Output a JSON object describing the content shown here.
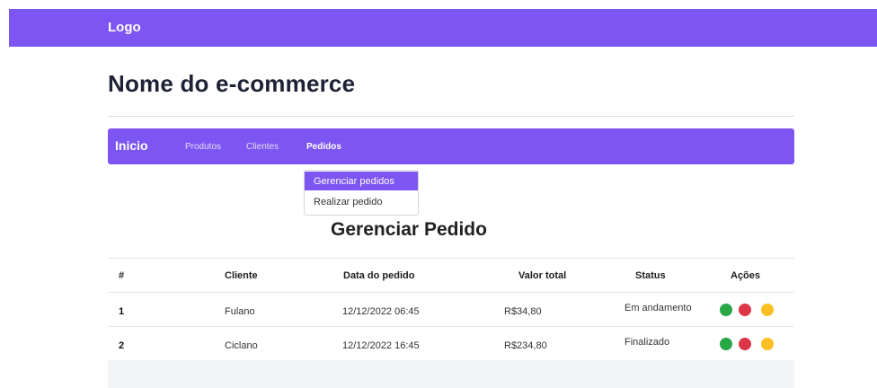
{
  "header": {
    "logo": "Logo"
  },
  "site": {
    "title": "Nome do e-commerce"
  },
  "nav": {
    "brand": "Inicio",
    "links": [
      "Produtos",
      "Clientes",
      "Pedidos"
    ],
    "active": "Pedidos"
  },
  "dropdown": {
    "items": [
      "Gerenciar pedidos",
      "Realizar pedido"
    ],
    "active": "Gerenciar pedidos"
  },
  "page": {
    "heading": "Gerenciar Pedido"
  },
  "table": {
    "headers": [
      "#",
      "Cliente",
      "Data do pedido",
      "Valor total",
      "Status",
      "Ações"
    ],
    "rows": [
      {
        "id": "1",
        "cliente": "Fulano",
        "data": "12/12/2022 06:45",
        "valor": "R$34,80",
        "status": "Em andamento"
      },
      {
        "id": "2",
        "cliente": "Ciclano",
        "data": "12/12/2022 16:45",
        "valor": "R$234,80",
        "status": "Finalizado"
      }
    ]
  },
  "actions": {
    "buttons": [
      {
        "icon": "green-action-icon",
        "color": "#28a745"
      },
      {
        "icon": "red-action-icon",
        "color": "#dc3545"
      },
      {
        "icon": "yellow-action-icon",
        "color": "#fbbf24"
      }
    ]
  },
  "colors": {
    "brand": "#7c55f2"
  }
}
